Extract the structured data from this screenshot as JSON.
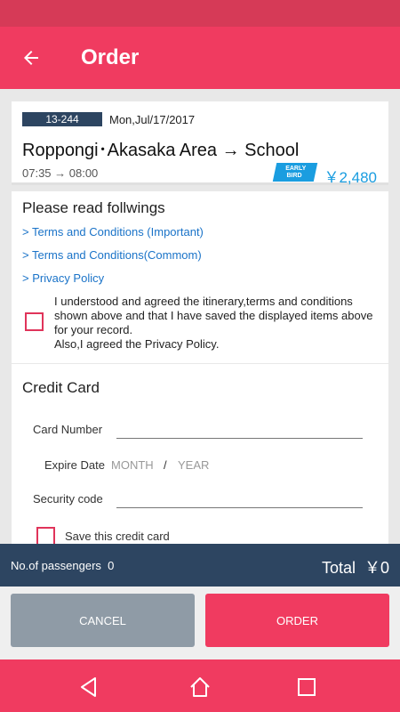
{
  "app": {
    "title": "Order"
  },
  "trip": {
    "code": "13-244",
    "date": "Mon,Jul/17/2017",
    "route": "Roppongi･Akasaka Area → School",
    "time": "07:35  →  08:00",
    "badge_line1": "EARLY",
    "badge_line2": "BIRD",
    "price": "￥2,480"
  },
  "terms": {
    "heading": "Please read follwings",
    "link_important": "> Terms and Conditions (Important)",
    "link_common": "> Terms and Conditions(Commom)",
    "link_privacy": "> Privacy Policy",
    "agreement_text": "I understood and agreed the itinerary,terms and conditions shown above and that I have saved the displayed items above for your record.",
    "agreement_text2": "Also,I agreed the Privacy Policy."
  },
  "credit_card": {
    "heading": "Credit Card",
    "card_number_label": "Card Number",
    "card_number_value": "",
    "expire_label": "Expire Date",
    "month_placeholder": "MONTH",
    "slash": "/",
    "year_placeholder": "YEAR",
    "security_label": "Security code",
    "security_value": "",
    "save_card_label": "Save this credit card"
  },
  "summary": {
    "passengers_label": "No.of passengers",
    "passengers_count": "0",
    "total_label": "Total",
    "total_value": "￥0"
  },
  "buttons": {
    "cancel": "CANCEL",
    "order": "ORDER"
  },
  "nav": {
    "back_icon": "back-triangle-icon",
    "home_icon": "home-icon",
    "recents_icon": "recents-square-icon"
  },
  "colors": {
    "primary": "#f03b60",
    "navy": "#2d4561",
    "accent_blue": "#1a9de0",
    "cancel_gray": "#8f9ba6"
  }
}
